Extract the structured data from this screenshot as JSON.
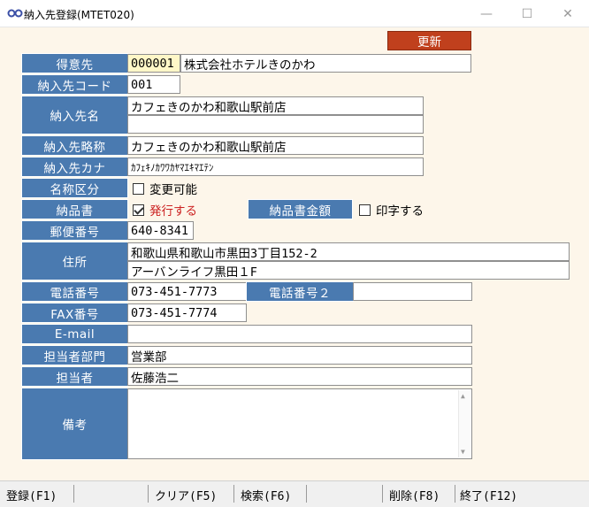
{
  "window": {
    "title": "納入先登録(MTET020)",
    "minimize_glyph": "—",
    "maximize_glyph": "☐",
    "close_glyph": "✕"
  },
  "toolbar": {
    "update_label": "更新"
  },
  "labels": {
    "customer": "得意先",
    "delivery_code": "納入先コード",
    "delivery_name": "納入先名",
    "delivery_short": "納入先略称",
    "delivery_kana": "納入先カナ",
    "name_category": "名称区分",
    "delivery_slip": "納品書",
    "slip_amount": "納品書金額",
    "postal_code": "郵便番号",
    "address": "住所",
    "phone": "電話番号",
    "phone2": "電話番号２",
    "fax": "FAX番号",
    "email": "E-mail",
    "dept": "担当者部門",
    "person": "担当者",
    "remarks": "備考"
  },
  "values": {
    "customer_code": "000001",
    "customer_name": "株式会社ホテルきのかわ",
    "delivery_code": "001",
    "delivery_name_1": "カフェきのかわ和歌山駅前店",
    "delivery_name_2": "",
    "delivery_short": "カフェきのかわ和歌山駅前店",
    "delivery_kana": "ｶﾌｪｷﾉｶﾜﾜｶﾔﾏｴｷﾏｴﾃﾝ",
    "name_changeable_label": "変更可能",
    "name_changeable_checked": false,
    "slip_issue_label": "発行する",
    "slip_issue_checked": true,
    "slip_issue_color": "#cc2222",
    "print_amount_label": "印字する",
    "print_amount_checked": false,
    "postal_code": "640-8341",
    "address_1": "和歌山県和歌山市黒田3丁目152-2",
    "address_2": "アーバンライフ黒田１F",
    "phone": "073-451-7773",
    "phone2": "",
    "fax": "073-451-7774",
    "email": "",
    "dept": "営業部",
    "person": "佐藤浩二",
    "remarks": ""
  },
  "function_keys": [
    "登録(F1)",
    "クリア(F5)",
    "検索(F6)",
    "削除(F8)",
    "終了(F12)"
  ],
  "colors": {
    "label_bg": "#4a7ab0",
    "update_button": "#c0401d",
    "form_bg": "#fdf6ea"
  }
}
